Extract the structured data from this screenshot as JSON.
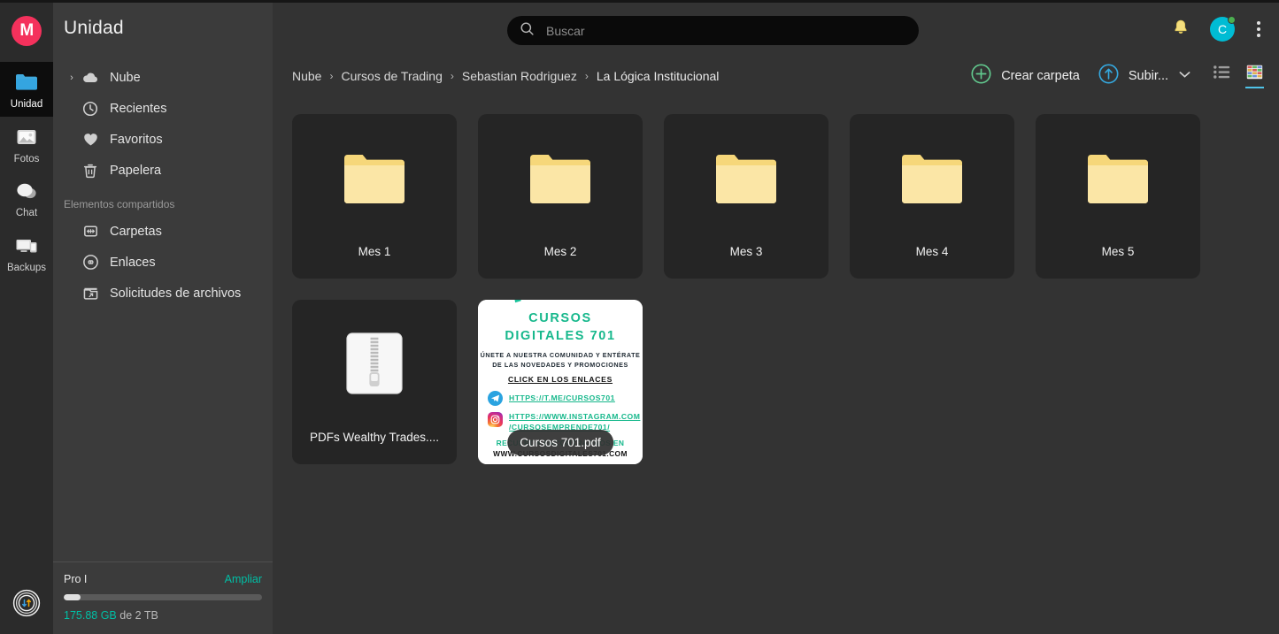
{
  "rail": {
    "logo": "M",
    "items": [
      {
        "label": "Unidad",
        "icon": "folder-icon",
        "active": true
      },
      {
        "label": "Fotos",
        "icon": "photos-icon",
        "active": false
      },
      {
        "label": "Chat",
        "icon": "chat-icon",
        "active": false
      },
      {
        "label": "Backups",
        "icon": "backups-icon",
        "active": false
      }
    ],
    "transfers_icon": "transfers-icon"
  },
  "nav": {
    "title": "Unidad",
    "items": [
      {
        "label": "Nube",
        "icon": "cloud-icon",
        "caret": "›"
      },
      {
        "label": "Recientes",
        "icon": "clock-icon",
        "caret": ""
      },
      {
        "label": "Favoritos",
        "icon": "heart-icon",
        "caret": ""
      },
      {
        "label": "Papelera",
        "icon": "trash-icon",
        "caret": ""
      }
    ],
    "section_label": "Elementos compartidos",
    "shared_items": [
      {
        "label": "Carpetas",
        "icon": "shared-folders-icon"
      },
      {
        "label": "Enlaces",
        "icon": "link-icon"
      },
      {
        "label": "Solicitudes de archivos",
        "icon": "file-request-icon"
      }
    ]
  },
  "storage": {
    "plan": "Pro I",
    "upgrade_label": "Ampliar",
    "used": "175.88 GB",
    "of_text": " de 2 TB",
    "percent": 8.6
  },
  "search": {
    "placeholder": "Buscar",
    "value": "",
    "icon": "search-icon"
  },
  "topbar": {
    "notifications_icon": "bell-icon",
    "avatar_initial": "C",
    "menu_icon": "kebab-menu-icon"
  },
  "breadcrumb": {
    "items": [
      "Nube",
      "Cursos de Trading",
      "Sebastian Rodriguez",
      "La Lógica Institucional"
    ],
    "separator": "›"
  },
  "actions": {
    "create_folder_label": "Crear carpeta",
    "create_folder_icon": "plus-circle-icon",
    "upload_label": "Subir...",
    "upload_icon": "upload-circle-icon",
    "upload_caret": "⌄",
    "list_view_icon": "list-view-icon",
    "grid_view_icon": "grid-view-icon",
    "active_view": "grid"
  },
  "files": [
    {
      "name": "Mes 1",
      "type": "folder",
      "icon": "folder-icon"
    },
    {
      "name": "Mes 2",
      "type": "folder",
      "icon": "folder-icon"
    },
    {
      "name": "Mes 3",
      "type": "folder",
      "icon": "folder-icon"
    },
    {
      "name": "Mes 4",
      "type": "folder",
      "icon": "folder-icon"
    },
    {
      "name": "Mes 5",
      "type": "folder",
      "icon": "folder-icon"
    },
    {
      "name": "PDFs Wealthy Trades....",
      "type": "zip",
      "icon": "zip-file-icon"
    },
    {
      "name": "Cursos 701.pdf",
      "type": "pdf-preview",
      "icon": "pdf-thumbnail"
    }
  ],
  "flyer": {
    "title_line1": "CURSOS",
    "title_line2": "DIGITALES 701",
    "sub_line1": "ÚNETE A NUESTRA COMUNIDAD Y ENTÉRATE",
    "sub_line2": "DE LAS NOVEDADES Y PROMOCIONES",
    "click_label": "CLICK EN LOS ENLACES",
    "telegram_url": "HTTPS://T.ME/CURSOS701",
    "instagram_url_line1": "HTTPS://WWW.INSTAGRAM.COM",
    "instagram_url_line2": "/CURSOSEMPRENDE701/",
    "footer_line1": "RECUERDA ENCONTRARNOS EN",
    "footer_line2": "WWW.CURSOSDIGITALES701.COM",
    "telegram_icon": "telegram-icon",
    "instagram_icon": "instagram-icon"
  },
  "colors": {
    "brand_red": "#f4315c",
    "accent_teal": "#00bfa5",
    "folder_yellow": "#fbdf8a",
    "avatar_teal": "#00bcd4",
    "status_green": "#4caf50",
    "view_underline": "#4fc3e8",
    "flyer_green": "#17b88c"
  }
}
